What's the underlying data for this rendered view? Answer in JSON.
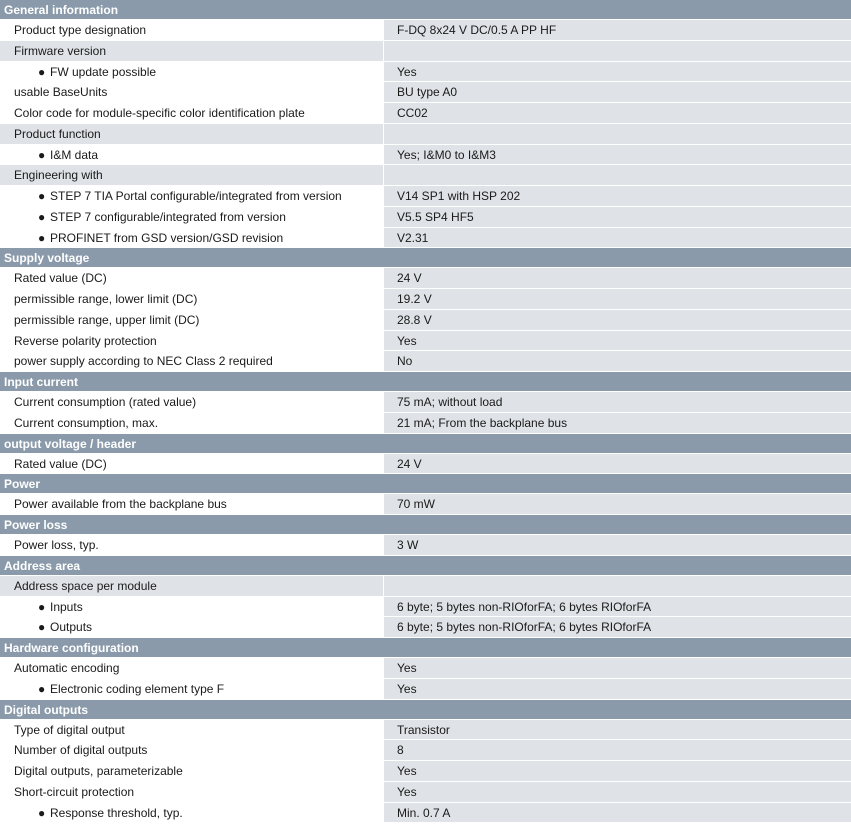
{
  "sections": [
    {
      "title": "General information",
      "rows": [
        {
          "label": "Product type designation",
          "value": "F-DQ 8x24 V DC/0.5 A PP HF",
          "level": 0
        },
        {
          "label": "Firmware version",
          "value": "",
          "level": 0,
          "group": true
        },
        {
          "label": "FW update possible",
          "value": "Yes",
          "level": 1
        },
        {
          "label": "usable BaseUnits",
          "value": "BU type A0",
          "level": 0
        },
        {
          "label": "Color code for module-specific color identification plate",
          "value": "CC02",
          "level": 0
        },
        {
          "label": "Product function",
          "value": "",
          "level": 0,
          "group": true
        },
        {
          "label": "I&M data",
          "value": "Yes; I&M0 to I&M3",
          "level": 1
        },
        {
          "label": "Engineering with",
          "value": "",
          "level": 0,
          "group": true
        },
        {
          "label": "STEP 7 TIA Portal configurable/integrated from version",
          "value": "V14 SP1 with HSP 202",
          "level": 1
        },
        {
          "label": "STEP 7 configurable/integrated from version",
          "value": "V5.5 SP4 HF5",
          "level": 1
        },
        {
          "label": "PROFINET from GSD version/GSD revision",
          "value": "V2.31",
          "level": 1
        }
      ]
    },
    {
      "title": "Supply voltage",
      "rows": [
        {
          "label": "Rated value (DC)",
          "value": "24 V",
          "level": 0
        },
        {
          "label": "permissible range, lower limit (DC)",
          "value": "19.2 V",
          "level": 0
        },
        {
          "label": "permissible range, upper limit (DC)",
          "value": "28.8 V",
          "level": 0
        },
        {
          "label": "Reverse polarity protection",
          "value": "Yes",
          "level": 0
        },
        {
          "label": "power supply according to NEC Class 2 required",
          "value": "No",
          "level": 0
        }
      ]
    },
    {
      "title": "Input current",
      "rows": [
        {
          "label": "Current consumption (rated value)",
          "value": "75 mA; without load",
          "level": 0
        },
        {
          "label": "Current consumption, max.",
          "value": "21 mA; From the backplane bus",
          "level": 0
        }
      ]
    },
    {
      "title": "output voltage / header",
      "rows": [
        {
          "label": "Rated value (DC)",
          "value": "24 V",
          "level": 0
        }
      ]
    },
    {
      "title": "Power",
      "rows": [
        {
          "label": "Power available from the backplane bus",
          "value": "70 mW",
          "level": 0
        }
      ]
    },
    {
      "title": "Power loss",
      "rows": [
        {
          "label": "Power loss, typ.",
          "value": "3 W",
          "level": 0
        }
      ]
    },
    {
      "title": "Address area",
      "rows": [
        {
          "label": "Address space per module",
          "value": "",
          "level": 0,
          "group": true
        },
        {
          "label": "Inputs",
          "value": "6 byte; 5 bytes non-RIOforFA; 6 bytes RIOforFA",
          "level": 1,
          "deep": true
        },
        {
          "label": "Outputs",
          "value": "6 byte; 5 bytes non-RIOforFA; 6 bytes RIOforFA",
          "level": 1,
          "deep": true
        }
      ]
    },
    {
      "title": "Hardware configuration",
      "rows": [
        {
          "label": "Automatic encoding",
          "value": "Yes",
          "level": 0
        },
        {
          "label": "Electronic coding element type F",
          "value": "Yes",
          "level": 1,
          "deep": true
        }
      ]
    },
    {
      "title": "Digital outputs",
      "rows": [
        {
          "label": "Type of digital output",
          "value": "Transistor",
          "level": 0
        },
        {
          "label": "Number of digital outputs",
          "value": "8",
          "level": 0
        },
        {
          "label": "Digital outputs, parameterizable",
          "value": "Yes",
          "level": 0
        },
        {
          "label": "Short-circuit protection",
          "value": "Yes",
          "level": 0
        },
        {
          "label": "Response threshold, typ.",
          "value": "Min. 0.7 A",
          "level": 1,
          "deep": true
        }
      ]
    }
  ],
  "bullet_glyph": "●"
}
